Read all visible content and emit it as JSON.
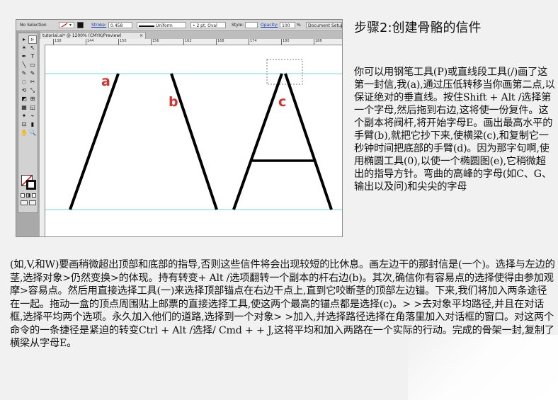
{
  "toolbar": {
    "selection": "No Selection",
    "stroke_label": "Stroke:",
    "stroke_value": "0.458",
    "profile": "Uniform",
    "brush": "2 pt. Oval",
    "style_label": "Style:",
    "opacity_label": "Opacity:",
    "opacity_value": "100",
    "opacity_unit": "%",
    "doc_setup": "Document Setup"
  },
  "document": {
    "tab_title": "tutorial.ai* @ 1200% (CMYK/Preview)",
    "tab_close": "×"
  },
  "ruler": {
    "ticks": [
      "138",
      "144",
      "150",
      "156",
      "162",
      "168",
      "174",
      "180",
      "186"
    ]
  },
  "tools": {
    "glyphs": [
      "▸",
      "▹",
      "✶",
      "↖",
      "✒",
      "T",
      "╲",
      "▭",
      "✎",
      "✎",
      "◌",
      "✂",
      "⟲",
      "⤡",
      "◩",
      "⊞",
      "▦",
      "◱",
      "✦",
      "⌁",
      "⊡",
      "▮",
      "✋",
      "🔍"
    ]
  },
  "canvas": {
    "labels": {
      "a": "a",
      "b": "b",
      "c": "c"
    },
    "colors": {
      "guide": "#73d6e8",
      "label": "#d0342c",
      "stroke": "#000000"
    }
  },
  "content": {
    "title": "步骤2:创建骨骼的信件",
    "right_paragraph": "你可以用钢笔工具(P)或直线段工具(/)画了这第一封信,我(a),通过压低转移当你画第二点,以保证绝对的垂直线。按住Shift + Alt /选择第一个字母,然后拖到右边,这将使一份复件。这个副本将阀杆,将开始字母E。画出最高水平的手臂(b),就把它抄下来,使横梁(c),和复制它一秒钟时间把底部的手臂(d)。因为那字句啊,使用椭圆工具(0),以使一个椭圆图(e),它稍微超出的指导方针。弯曲的高峰的字母(如C、G、输出以及问)和尖尖的字母",
    "bottom_paragraph": "(如,V,和W)要画稍微超出顶部和底部的指导,否则这些信件将会出现较短的比休息。画左边干的那封信是(一个)。选择与左边的茎,选择对象>仍然变换>的体现。持有转变+ Alt /选项翻转一个副本的杆右边(b)。其次,确信你有容易点的选择使得由参加观摩>容易点。然后用直接选择工具(一)来选择顶部锚点在右边干点上,直到它咬断茎的顶部左边锚。下来,我们将加入两条途径在一起。拖动一盒的顶点周围贴上邮票的直接选择工具,使这两个最高的锚点都是选择(c)。> >去对象平均路径,并且在对话框,选择平均两个选项。永久加入他们的道路,选择到一个对象> >加入,并选择路径选择在角落里加入对话框的窗口。对这两个命令的一条捷径是紧迫的转变Ctrl + Alt /选择/ Cmd + + J,这将平均和加入两路在一个实际的行动。完成的骨架一封,复制了横梁从字母E。"
  }
}
